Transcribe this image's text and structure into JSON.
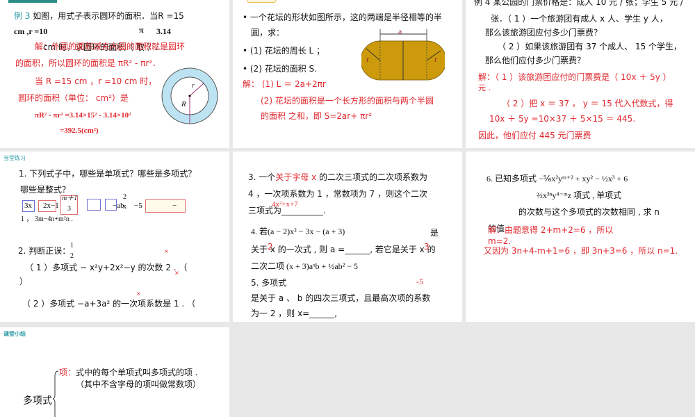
{
  "slide1": {
    "example": "例 3",
    "q1": "如图，用式子表示圆环的面积．当R =15",
    "q2": "cm ,r =10",
    "q2b": "π",
    "q2c": "3.14",
    "q3": "cm 时，求圆环的面积（ 取 ）.",
    "a1": "解：外圆的面积减去内圆的面积就是圆环",
    "a2": "的面积，所以圆环的面积是 πR² - πr²．",
    "a3": "当 R =15  cm ，r =10   cm 时，",
    "a4": "圆环的面积（单位： cm²）是",
    "a5": "πR² - πr² =3.14×15² - 3.14×10²",
    "a6": "=392.5(cm²)",
    "label_r": "r",
    "label_R": "R"
  },
  "slide2": {
    "b1": "一个花坛的形状如图所示，这的两端是半径相等的半",
    "b1b": "圆，求：",
    "b2": "(1) 花坛的周长 L ；",
    "b3": "(2) 花坛的面积 S.",
    "s1": "解： (1) L ＝ 2a+2πr",
    "s2": "(2)  花坛的面积是一个长方形的面积与两个半圆",
    "s3": "的面积  之和，即 S=2ar+ πr²",
    "label_a": "a",
    "label_r": "r"
  },
  "slide3": {
    "q1": "例 4 某公园的门票价格是：成人 10 元 / 张；学生 5 元 /",
    "q2": "张．（ 1 ）一个旅游团有成人 x 人、学生 y 人，",
    "q3": "那么该旅游团应付多少门票费？",
    "q4": "（ 2 ）如果该旅游团有 37 个成人、 15 个学生，",
    "q5": "那么他们应付多少门票费？",
    "a1": "解：（ 1 ）该旅游团应付的门票费是（ 10x ＋ 5y ）",
    "a1b": "元 .",
    "a2": "（ 2 ）把 x ＝ 37 ， y ＝ 15 代入代数式，得",
    "a3": "10x ＋ 5y =10×37 ＋ 5×15  ＝ 445.",
    "a4": "因此，他们应付 445 元门票费"
  },
  "slide4": {
    "header": "当堂练习",
    "q1": "1. 下列式子中，哪些是单项式？哪些是多项式？",
    "q1b": "哪些是整式？",
    "e1": "3x",
    "e2": "2x−1",
    "e3": "m＋1",
    "e3b": "3",
    "e4": "−ab",
    "e5": "2",
    "e5b": "x",
    "e6": "−5",
    "e7": "−",
    "q1c": "1 ，  3m−4n+m²n .",
    "q2": "2. 判断正误：",
    "half": "1",
    "half_b": "2",
    "q2a": "（ 1 ）多项式 −    x²y+2x²−y 的次数 2 .  （",
    "q2a2": "）",
    "q2b": "（ 2 ）多项式  −a+3a² 的一次项系数是 1 .  （",
    "mark": "×"
  },
  "slide5": {
    "q3a": "3. 一个",
    "q3red": "关于字母 x",
    "q3b": " 的二次三项式的二次项系数为",
    "q3c": "4 ，一次项系数为 1 ，常数项为 7 ，则这个二次",
    "q3d": "三项式为__________.",
    "ans3": "4x²+x+7",
    "q4a": "4. 若(a − 2)x² − 3x − (a + 3)",
    "q4a2": "是",
    "q4b": "关于 x 的一次式 , 则 a =______, 若它是关于 x 的",
    "ans4a": "2",
    "ans4b": "3",
    "q4c": "二次二项 (x + 3)aˣb + ½ab² − 5",
    "q5a": "5. 多项式",
    "ans5": "-5",
    "q5b": "是关于 a 、 b 的四次三项式，且最高次项的系数",
    "q5c": "为一 2 ，则 x=______,"
  },
  "slide6": {
    "q6a": "6. 已知多项式 −⅚x²yᵐ⁺² + xy² − ½x³ + 6",
    "q6b": "⅔x³ⁿy⁴⁻ᵐz 项式 , 单项式",
    "q6c": "的次数与这个多项式的次数相同 , 求 n",
    "q6d": "的值",
    "a1": "解：由题意得 2+m+2=6 ，所以",
    "a1b": "m=2.",
    "a2": "又因为 3n+4-m+1=6 ，即 3n+3=6 ，所以 n=1."
  },
  "slide7": {
    "header": "课堂小结",
    "poly": "多项式",
    "term_label": "项：",
    "term_def": "式中的每个单项式叫多项式的项 .",
    "term_note": "（其中不含字母的项叫做常数项）"
  }
}
